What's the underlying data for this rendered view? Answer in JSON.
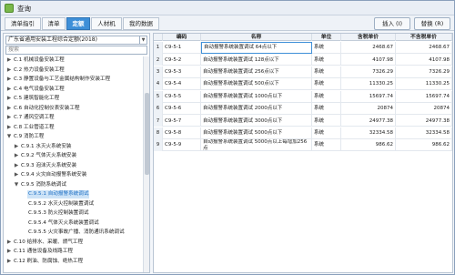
{
  "window": {
    "title": "查询"
  },
  "tabs": [
    "清单指引",
    "清单",
    "定额",
    "人材机",
    "我的数据"
  ],
  "toolbar": {
    "insert_label": "插入 (I)",
    "replace_label": "替换 (R)"
  },
  "left": {
    "library": "广东省通用安装工程综合定额(2018)",
    "search_placeholder": "搜索",
    "tree": [
      {
        "exp": "▶",
        "label": "C.1 机械设备安装工程"
      },
      {
        "exp": "▶",
        "label": "C.2 热力设备安装工程"
      },
      {
        "exp": "▶",
        "label": "C.3 静置设备与工艺金属结构制作安装工程"
      },
      {
        "exp": "▶",
        "label": "C.4 电气设备安装工程"
      },
      {
        "exp": "▶",
        "label": "C.5 建筑智能化工程"
      },
      {
        "exp": "▶",
        "label": "C.6 自动化控制仪表安装工程"
      },
      {
        "exp": "▶",
        "label": "C.7 通风空调工程"
      },
      {
        "exp": "▶",
        "label": "C.8 工业管道工程"
      },
      {
        "exp": "▼",
        "label": "C.9 消防工程"
      },
      {
        "exp": "▶",
        "label": "C.9.1 水灭火系统安装"
      },
      {
        "exp": "▶",
        "label": "C.9.2 气体灭火系统安装"
      },
      {
        "exp": "▶",
        "label": "C.9.3 泡沫灭火系统安装"
      },
      {
        "exp": "▶",
        "label": "C.9.4 火灾自动报警系统安装"
      },
      {
        "exp": "▼",
        "label": "C.9.5 消防系统调试"
      },
      {
        "exp": "",
        "label": "C.9.5.1 自动报警系统调试"
      },
      {
        "exp": "",
        "label": "C.9.5.2 水灭火控制装置调试"
      },
      {
        "exp": "",
        "label": "C.9.5.3 防火控制装置调试"
      },
      {
        "exp": "",
        "label": "C.9.5.4 气体灭火系统装置调试"
      },
      {
        "exp": "",
        "label": "C.9.5.5 火灾事故广播、消防通讯系统调试"
      },
      {
        "exp": "▶",
        "label": "C.10 给排水、采暖、燃气工程"
      },
      {
        "exp": "▶",
        "label": "C.11 通信设备及线路工程"
      },
      {
        "exp": "▶",
        "label": "C.12 刷油、防腐蚀、绝热工程"
      }
    ]
  },
  "table": {
    "columns": [
      "编码",
      "名称",
      "单位",
      "含税单价",
      "不含税单价"
    ],
    "rows": [
      {
        "idx": "1",
        "code": "C9-5-1",
        "name": "自动报警系统装置调试 64点以下",
        "unit": "系统",
        "tax": "2468.67",
        "notax": "2468.67"
      },
      {
        "idx": "2",
        "code": "C9-5-2",
        "name": "自动报警系统装置调试 128点以下",
        "unit": "系统",
        "tax": "4107.98",
        "notax": "4107.98"
      },
      {
        "idx": "3",
        "code": "C9-5-3",
        "name": "自动报警系统装置调试 256点以下",
        "unit": "系统",
        "tax": "7326.29",
        "notax": "7326.29"
      },
      {
        "idx": "4",
        "code": "C9-5-4",
        "name": "自动报警系统装置调试 500点以下",
        "unit": "系统",
        "tax": "11330.25",
        "notax": "11330.25"
      },
      {
        "idx": "5",
        "code": "C9-5-5",
        "name": "自动报警系统装置调试 1000点以下",
        "unit": "系统",
        "tax": "15697.74",
        "notax": "15697.74"
      },
      {
        "idx": "6",
        "code": "C9-5-6",
        "name": "自动报警系统装置调试 2000点以下",
        "unit": "系统",
        "tax": "20874",
        "notax": "20874"
      },
      {
        "idx": "7",
        "code": "C9-5-7",
        "name": "自动报警系统装置调试 3000点以下",
        "unit": "系统",
        "tax": "24977.38",
        "notax": "24977.38"
      },
      {
        "idx": "8",
        "code": "C9-5-8",
        "name": "自动报警系统装置调试 5000点以下",
        "unit": "系统",
        "tax": "32334.58",
        "notax": "32334.58"
      },
      {
        "idx": "9",
        "code": "C9-5-9",
        "name": "自动报警系统装置调试 5000点以上每增加256点",
        "unit": "系统",
        "tax": "986.62",
        "notax": "986.62"
      }
    ]
  },
  "colors": {
    "accent": "#3e8fd8",
    "selection": "#cde3f7"
  }
}
